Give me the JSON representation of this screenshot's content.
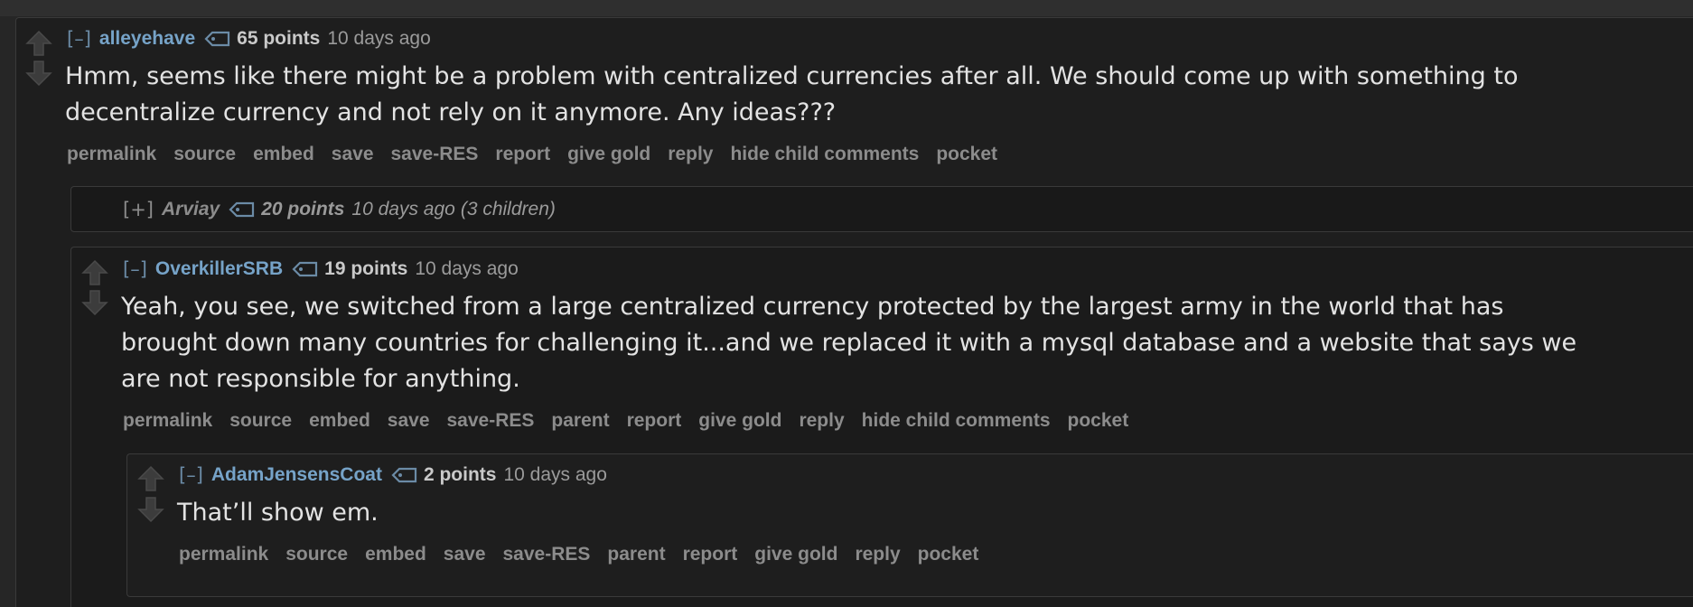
{
  "comments": [
    {
      "expand": "[–]",
      "author": "alleyehave",
      "points": "65 points",
      "time": "10 days ago",
      "body": [
        "Hmm, seems like there might be a problem with centralized currencies after all. We should come up with something to",
        "decentralize currency and not rely on it anymore. Any ideas???"
      ],
      "buttons": [
        "permalink",
        "source",
        "embed",
        "save",
        "save-RES",
        "report",
        "give gold",
        "reply",
        "hide child comments",
        "pocket"
      ]
    },
    {
      "expand": "[+]",
      "author": "Arviay",
      "points": "20 points",
      "time": "10 days ago",
      "children": "(3 children)"
    },
    {
      "expand": "[–]",
      "author": "OverkillerSRB",
      "points": "19 points",
      "time": "10 days ago",
      "body": [
        "Yeah, you see, we switched from a large centralized currency protected by the largest army in the world that has",
        "brought down many countries for challenging it...and we replaced it with a mysql database and a website that says we",
        "are not responsible for anything."
      ],
      "buttons": [
        "permalink",
        "source",
        "embed",
        "save",
        "save-RES",
        "parent",
        "report",
        "give gold",
        "reply",
        "hide child comments",
        "pocket"
      ]
    },
    {
      "expand": "[–]",
      "author": "AdamJensensCoat",
      "points": "2 points",
      "time": "10 days ago",
      "body": [
        "That’ll show em."
      ],
      "buttons": [
        "permalink",
        "source",
        "embed",
        "save",
        "save-RES",
        "parent",
        "report",
        "give gold",
        "reply",
        "pocket"
      ]
    }
  ],
  "icons": {
    "upvote": "upvote-arrow-icon",
    "downvote": "downvote-arrow-icon",
    "tag": "tag-icon"
  },
  "colors": {
    "author": "#76a3c8",
    "buttons": "#8c8c8c",
    "body_text": "#e3e3e3"
  }
}
